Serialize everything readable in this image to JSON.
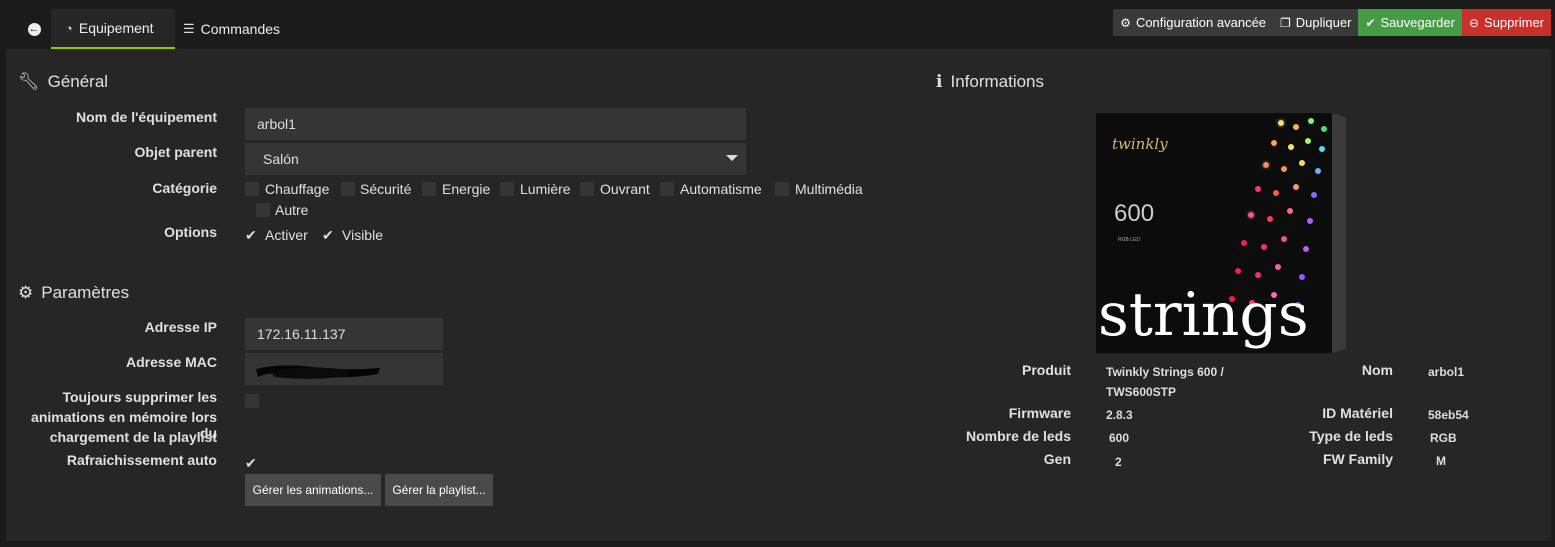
{
  "tabs": {
    "equipment": "Equipement",
    "commands": "Commandes"
  },
  "toolbar": {
    "advanced": "Configuration avancée",
    "duplicate": "Dupliquer",
    "save": "Sauvegarder",
    "delete": "Supprimer"
  },
  "general": {
    "title": "Général",
    "name_label": "Nom de l'équipement",
    "name_value": "arbol1",
    "parent_label": "Objet parent",
    "parent_value": "Salón",
    "category_label": "Catégorie",
    "categories": [
      "Chauffage",
      "Sécurité",
      "Energie",
      "Lumière",
      "Ouvrant",
      "Automatisme",
      "Multimédia",
      "Autre"
    ],
    "options_label": "Options",
    "opt_enable": "Activer",
    "opt_visible": "Visible"
  },
  "params": {
    "title": "Paramètres",
    "ip_label": "Adresse IP",
    "ip_value": "172.16.11.137",
    "mac_label": "Adresse MAC",
    "delete_anim_label_1": "Toujours supprimer les",
    "delete_anim_label_2": "animations en mémoire lors du",
    "delete_anim_label_3": "chargement de la playlist",
    "refresh_label": "Rafraichissement auto",
    "manage_anims": "Gérer les animations...",
    "manage_playlist": "Gérer la playlist..."
  },
  "info": {
    "title": "Informations",
    "product_label": "Produit",
    "product_value_1": "Twinkly Strings 600   /",
    "product_value_2": "TWS600STP",
    "firmware_label": "Firmware",
    "firmware_value": "2.8.3",
    "leds_label": "Nombre de leds",
    "leds_value": "600",
    "gen_label": "Gen",
    "gen_value": "2",
    "name_label": "Nom",
    "name_value": "arbol1",
    "hwid_label": "ID Matériel",
    "hwid_value": "58eb54",
    "ledtype_label": "Type de leds",
    "ledtype_value": "RGB",
    "fwfamily_label": "FW Family",
    "fwfamily_value": "M"
  },
  "box_art": {
    "brand": "twinkly",
    "count": "600",
    "subtitle": "RGB LED",
    "product": "strings"
  },
  "colors": {
    "accent": "#94ca02",
    "save": "#449d44",
    "delete": "#c9302c",
    "panel": "#262626",
    "input": "#353535"
  }
}
